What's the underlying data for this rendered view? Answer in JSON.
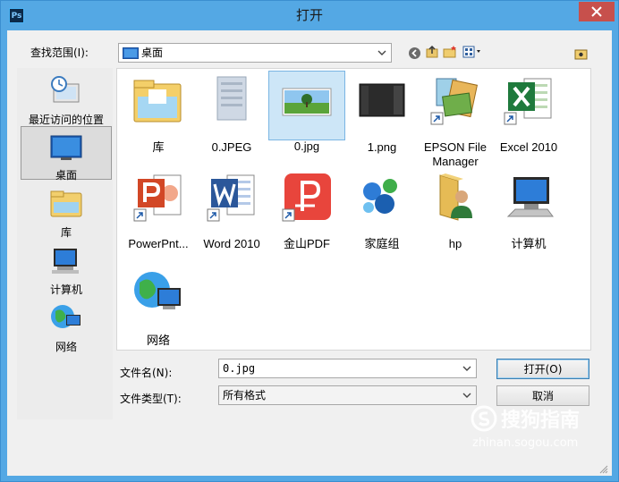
{
  "window": {
    "title": "打开",
    "app_icon_text": "Ps"
  },
  "toolbar": {
    "look_in_label": "查找范围(I):",
    "look_in_value": "桌面"
  },
  "places": [
    {
      "label": "最近访问的位置",
      "icon": "recent-places-icon"
    },
    {
      "label": "桌面",
      "icon": "desktop-icon",
      "selected": true
    },
    {
      "label": "库",
      "icon": "library-icon"
    },
    {
      "label": "计算机",
      "icon": "computer-icon"
    },
    {
      "label": "网络",
      "icon": "network-icon"
    }
  ],
  "files": [
    {
      "name": "库",
      "icon": "library-folder-icon"
    },
    {
      "name": "0.JPEG",
      "icon": "image-file-icon"
    },
    {
      "name": "0.jpg",
      "icon": "image-file-icon",
      "selected": true
    },
    {
      "name": "1.png",
      "icon": "image-file-icon"
    },
    {
      "name": "EPSON File Manager",
      "icon": "epson-shortcut-icon"
    },
    {
      "name": "Excel 2010",
      "icon": "excel-shortcut-icon"
    },
    {
      "name": "PowerPnt...",
      "icon": "powerpoint-shortcut-icon"
    },
    {
      "name": "Word 2010",
      "icon": "word-shortcut-icon"
    },
    {
      "name": "金山PDF",
      "icon": "kingsoft-pdf-shortcut-icon"
    },
    {
      "name": "家庭组",
      "icon": "homegroup-icon"
    },
    {
      "name": "hp",
      "icon": "user-folder-icon"
    },
    {
      "name": "计算机",
      "icon": "computer-icon"
    },
    {
      "name": "网络",
      "icon": "network-icon"
    }
  ],
  "form": {
    "filename_label": "文件名(N):",
    "filename_value": "0.jpg",
    "filetype_label": "文件类型(T):",
    "filetype_value": "所有格式",
    "open_label": "打开(O)",
    "cancel_label": "取消"
  },
  "watermark": {
    "brand": "搜狗指南",
    "url": "zhinan.sogou.com"
  },
  "colors": {
    "titlebar": "#54a8e4",
    "close": "#c7504c",
    "selection": "#cde6f7"
  }
}
